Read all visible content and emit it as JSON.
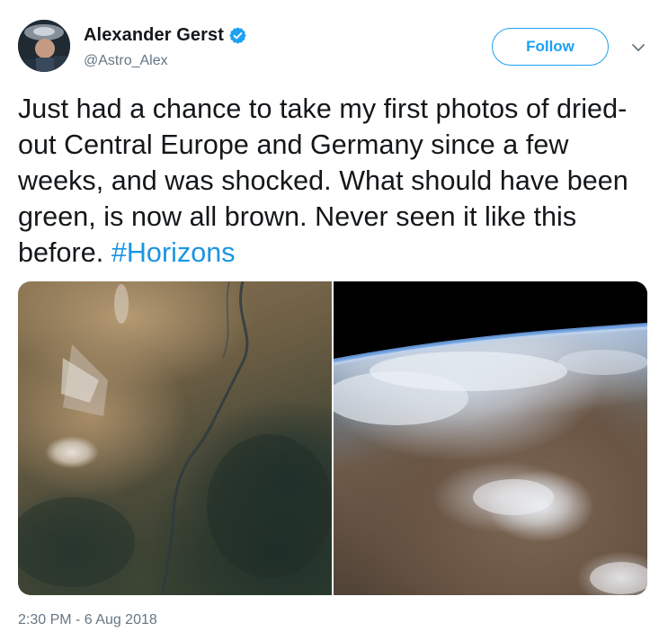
{
  "author": {
    "display_name": "Alexander Gerst",
    "handle": "@Astro_Alex",
    "verified_icon": "verified-badge-icon",
    "avatar_icon": "avatar"
  },
  "actions": {
    "follow_label": "Follow",
    "caret_icon": "chevron-down-icon"
  },
  "tweet": {
    "text": "Just had a chance to take my first photos of dried-out Central Europe and Germany since a few weeks, and was shocked. What should have been green, is now all brown. Never seen it like this before. ",
    "hashtag": "#Horizons",
    "timestamp": "2:30 PM - 6 Aug 2018"
  },
  "media": {
    "photos": [
      {
        "subject": "dried-out farmland with river, seen from orbit"
      },
      {
        "subject": "curved Earth horizon over brown Central Europe with clouds"
      }
    ]
  },
  "colors": {
    "link": "#1b95e0",
    "accent": "#1da1f2",
    "secondary_text": "#657786",
    "primary_text": "#14171a"
  }
}
